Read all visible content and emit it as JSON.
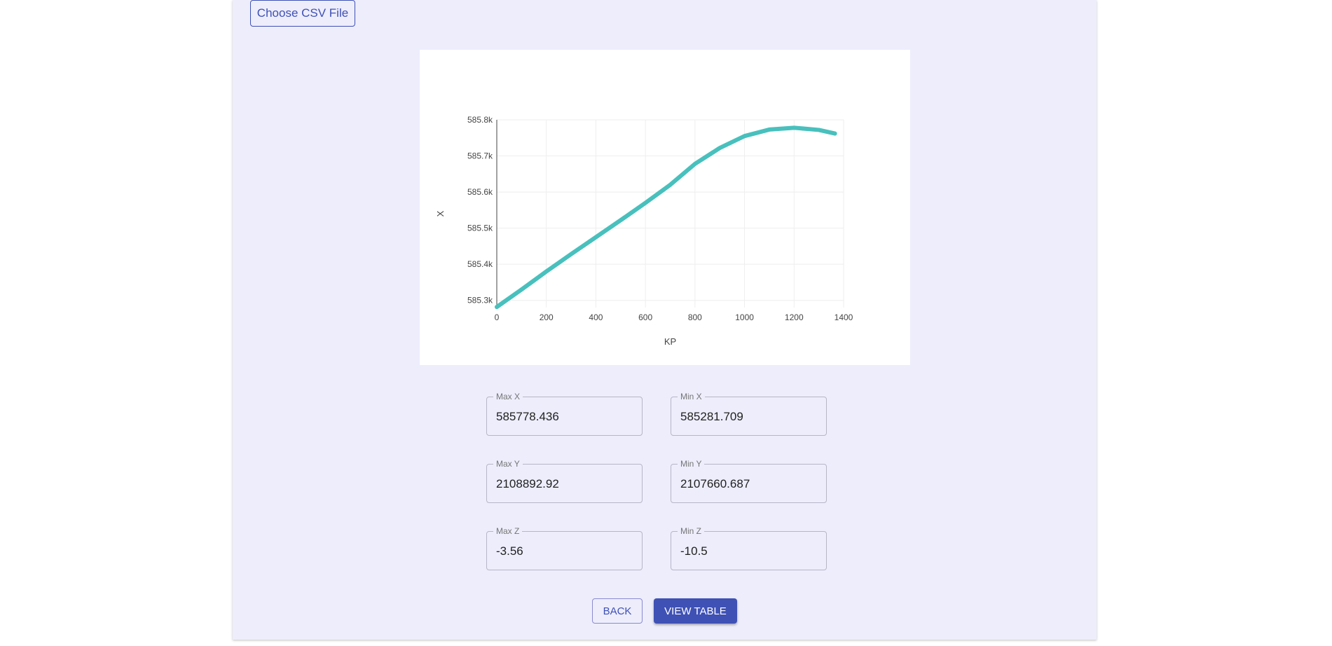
{
  "upload": {
    "choose_label": "Choose CSV File"
  },
  "chart_data": {
    "type": "line",
    "title": "",
    "xlabel": "KP",
    "ylabel": "X",
    "xlim": [
      0,
      1400
    ],
    "ylim": [
      585280,
      585800
    ],
    "x_ticks": [
      0,
      200,
      400,
      600,
      800,
      1000,
      1200,
      1400
    ],
    "x_tick_labels": [
      "0",
      "200",
      "400",
      "600",
      "800",
      "1000",
      "1200",
      "1400"
    ],
    "y_ticks": [
      585300,
      585400,
      585500,
      585600,
      585700,
      585800
    ],
    "y_tick_labels": [
      "585.3k",
      "585.4k",
      "585.5k",
      "585.6k",
      "585.7k",
      "585.8k"
    ],
    "grid": true,
    "line_color": "#48c0bd",
    "series": [
      {
        "x": [
          0,
          100,
          200,
          300,
          400,
          500,
          600,
          700,
          800,
          900,
          1000,
          1100,
          1200,
          1300,
          1365
        ],
        "y": [
          585281.7,
          585330,
          585380,
          585428,
          585475,
          585522,
          585570,
          585620,
          585678,
          585722,
          585755,
          585773,
          585778,
          585772,
          585762
        ]
      }
    ]
  },
  "stats": {
    "max_x": {
      "label": "Max X",
      "value": "585778.436"
    },
    "min_x": {
      "label": "Min X",
      "value": "585281.709"
    },
    "max_y": {
      "label": "Max Y",
      "value": "2108892.92"
    },
    "min_y": {
      "label": "Min Y",
      "value": "2107660.687"
    },
    "max_z": {
      "label": "Max Z",
      "value": "-3.56"
    },
    "min_z": {
      "label": "Min Z",
      "value": "-10.5"
    }
  },
  "actions": {
    "back_label": "BACK",
    "view_table_label": "VIEW TABLE"
  },
  "colors": {
    "accent": "#3f51b5",
    "panel_bg": "#ededfc"
  }
}
